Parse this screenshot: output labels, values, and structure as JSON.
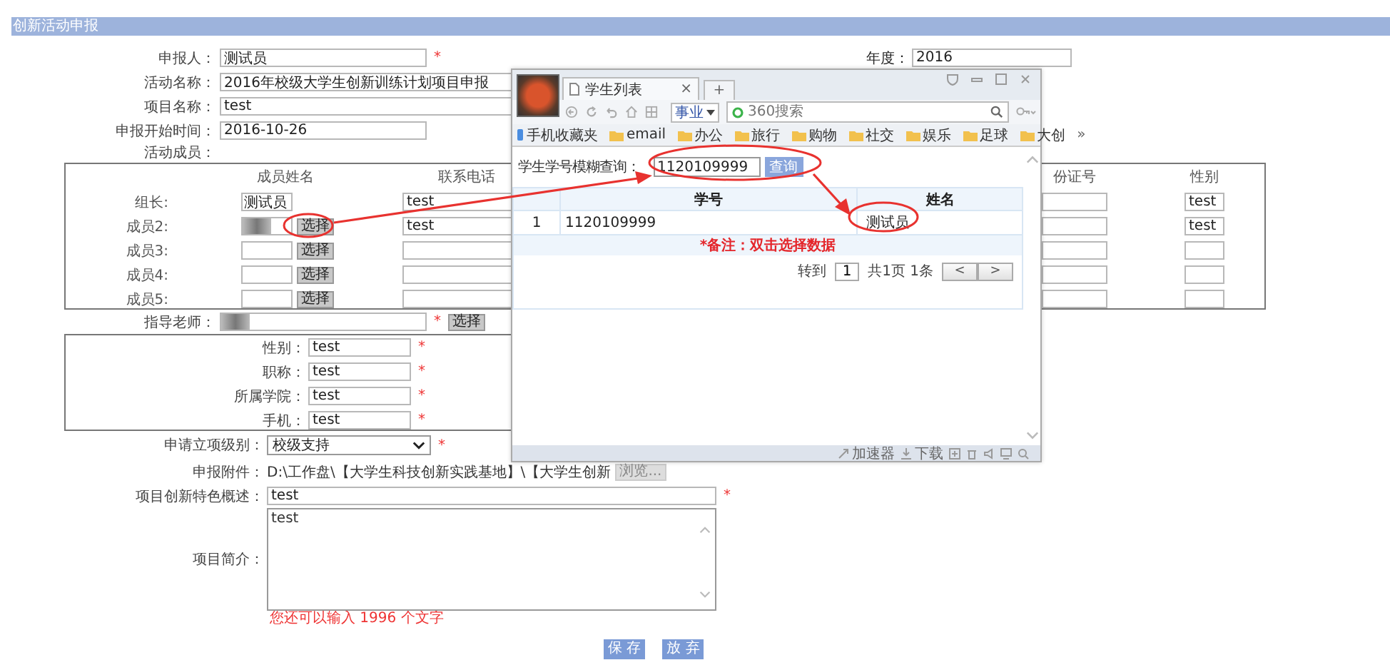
{
  "page": {
    "title": "创新活动申报"
  },
  "form": {
    "reporter": {
      "label": "申报人：",
      "value": "测试员",
      "note": "*"
    },
    "year": {
      "label": "年度：",
      "value": "2016"
    },
    "activity_name": {
      "label": "活动名称：",
      "value": "2016年校级大学生创新训练计划项目申报"
    },
    "project_name": {
      "label": "项目名称：",
      "value": "test"
    },
    "start_date": {
      "label": "申报开始时间：",
      "value": "2016-10-26"
    },
    "members_label": "活动成员：",
    "members": {
      "columns": {
        "name": "成员姓名",
        "phone": "联系电话",
        "id_number": "份证号",
        "gender": "性别"
      },
      "rows": [
        {
          "label": "组长:",
          "name": "测试员",
          "blurred": false,
          "phone": "test",
          "gender": "test"
        },
        {
          "label": "成员2:",
          "name": "",
          "blurred": true,
          "button": "选择",
          "phone": "test",
          "gender": "test"
        },
        {
          "label": "成员3:",
          "name": "",
          "blurred": false,
          "button": "选择",
          "phone": "",
          "gender": ""
        },
        {
          "label": "成员4:",
          "name": "",
          "blurred": false,
          "button": "选择",
          "phone": "",
          "gender": ""
        },
        {
          "label": "成员5:",
          "name": "",
          "blurred": false,
          "button": "选择",
          "phone": "",
          "gender": ""
        }
      ]
    },
    "teacher": {
      "label": "指导老师：",
      "blurred": true,
      "note": "*",
      "button": "选择",
      "details": [
        {
          "label": "性别：",
          "value": "test",
          "note": "*"
        },
        {
          "label": "职称：",
          "value": "test",
          "note": "*"
        },
        {
          "label": "所属学院：",
          "value": "test",
          "note": "*"
        },
        {
          "label": "手机：",
          "value": "test",
          "note": "*"
        }
      ]
    },
    "level": {
      "label": "申请立项级别：",
      "value": "校级支持",
      "note": "*"
    },
    "attachment": {
      "label": "申报附件：",
      "path": "D:\\工作盘\\【大学生科技创新实践基地】\\【大学生创新",
      "button": "浏览..."
    },
    "feature": {
      "label": "项目创新特色概述：",
      "value": "test",
      "note": "*"
    },
    "intro": {
      "label": "项目简介：",
      "value": "test",
      "hint": "您还可以输入 1996 个文字"
    },
    "buttons": [
      "保 存",
      "放 弃"
    ]
  },
  "popup": {
    "tab": {
      "title": "学生列表",
      "close": "×"
    },
    "new_tab": "+",
    "engine": "事业",
    "address": {
      "placeholder": "360搜索"
    },
    "bookmarks": [
      {
        "kind": "phone",
        "label": "手机收藏夹"
      },
      {
        "kind": "folder",
        "label": "email"
      },
      {
        "kind": "folder",
        "label": "办公"
      },
      {
        "kind": "folder",
        "label": "旅行"
      },
      {
        "kind": "folder",
        "label": "购物"
      },
      {
        "kind": "folder",
        "label": "社交"
      },
      {
        "kind": "folder",
        "label": "娱乐"
      },
      {
        "kind": "folder",
        "label": "足球"
      },
      {
        "kind": "folder",
        "label": "大创"
      }
    ],
    "more": "»",
    "query": {
      "label": "学生学号模糊查询：",
      "value": "1120109999",
      "button": "查询"
    },
    "table": {
      "columns": [
        "",
        "学号",
        "姓名"
      ],
      "rows": [
        [
          "1",
          "1120109999",
          "测试员"
        ]
      ]
    },
    "note": "*备注：双击选择数据",
    "pager": {
      "goto": "转到",
      "page": "1",
      "total": "共1页 1条",
      "prev": "<",
      "next": ">"
    },
    "status": [
      "加速器",
      "下载"
    ]
  }
}
